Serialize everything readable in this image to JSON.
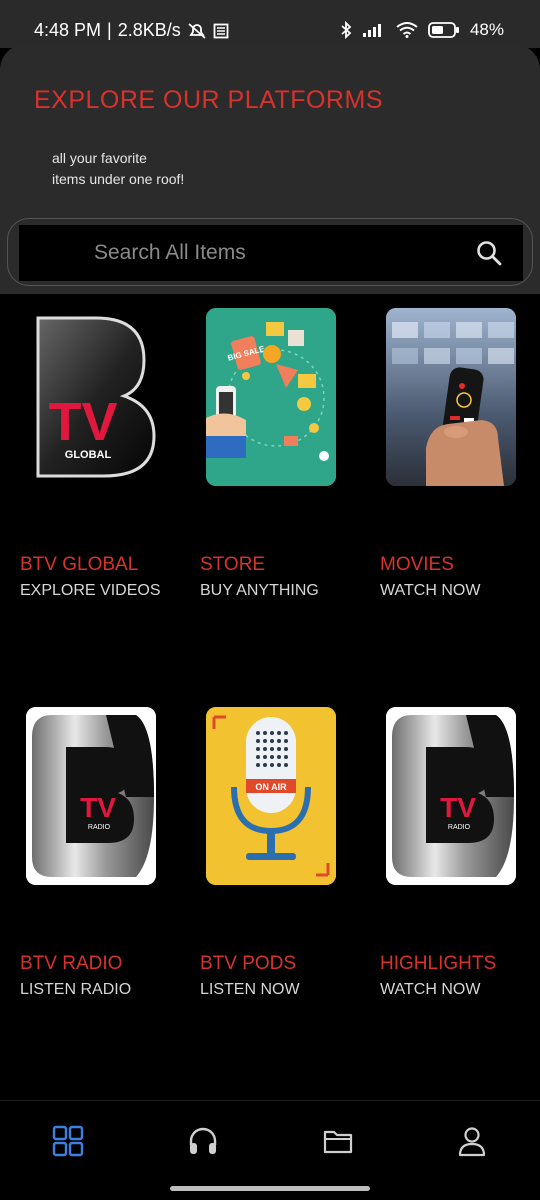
{
  "status_bar": {
    "time": "4:48 PM",
    "speed": "2.8KB/s",
    "battery": "48%"
  },
  "header": {
    "title": "EXPLORE OUR PLATFORMS",
    "subtitle": "all your favorite\nitems under one roof!"
  },
  "search": {
    "placeholder": "Search All Items"
  },
  "platforms": [
    {
      "title": "BTV GLOBAL",
      "subtitle": "EXPLORE VIDEOS",
      "thumb_text": "TV",
      "thumb_caption": "GLOBAL"
    },
    {
      "title": "STORE",
      "subtitle": "BUY ANYTHING",
      "thumb_text": "BIG SALE"
    },
    {
      "title": "MOVIES",
      "subtitle": "WATCH NOW"
    },
    {
      "title": "BTV RADIO",
      "subtitle": "LISTEN RADIO",
      "thumb_text": "TV",
      "thumb_caption": "RADIO"
    },
    {
      "title": "BTV PODS",
      "subtitle": "LISTEN NOW",
      "thumb_text": "ON AIR"
    },
    {
      "title": "HIGHLIGHTS",
      "subtitle": "WATCH NOW",
      "thumb_text": "TV",
      "thumb_caption": "RADIO"
    }
  ],
  "bottom_nav": [
    {
      "icon": "grid-icon",
      "active": true
    },
    {
      "icon": "headphones-icon",
      "active": false
    },
    {
      "icon": "folder-icon",
      "active": false
    },
    {
      "icon": "user-icon",
      "active": false
    }
  ],
  "colors": {
    "accent": "#d8322c",
    "nav_active": "#3f7fe0",
    "nav_inactive": "#cfcfcf",
    "header_bg": "#2b2b2b"
  }
}
